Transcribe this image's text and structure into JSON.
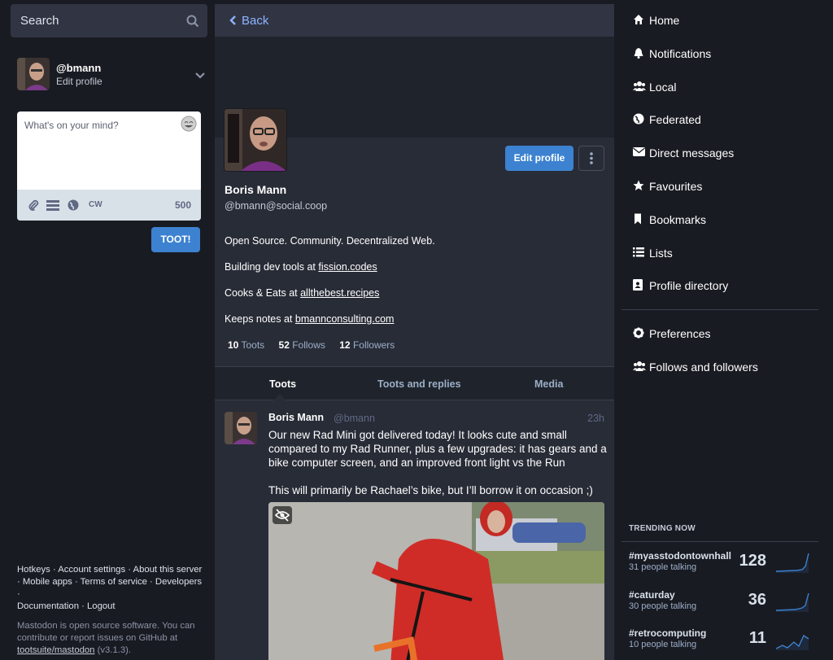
{
  "search": {
    "placeholder": "Search"
  },
  "account": {
    "handle": "@bmann",
    "edit_label": "Edit profile"
  },
  "composer": {
    "placeholder": "What's on your mind?",
    "cw_label": "CW",
    "char_count": "500",
    "toot_label": "TOOT!"
  },
  "footer": {
    "links_line1": "Hotkeys · Account settings · About this server",
    "links_line2": "· Mobile apps · Terms of service · Developers ·",
    "links_line3": "Documentation · Logout",
    "about_line1": "Mastodon is open source software. You can",
    "about_line2": "contribute or report issues on GitHub at",
    "repo": "tootsuite/mastodon",
    "version": " (v3.1.3)."
  },
  "header": {
    "back_label": "Back"
  },
  "profile": {
    "edit_label": "Edit profile",
    "name": "Boris Mann",
    "acct": "@bmann@social.coop",
    "bio1": "Open Source. Community. Decentralized Web.",
    "bio2_prefix": "Building dev tools at ",
    "bio2_link": "fission.codes",
    "bio3_prefix": "Cooks & Eats at ",
    "bio3_link": "allthebest.recipes",
    "bio4_prefix": "Keeps notes at ",
    "bio4_link": "bmannconsulting.com",
    "toots_count": "10",
    "toots_label": "Toots",
    "follows_count": "52",
    "follows_label": "Follows",
    "followers_count": "12",
    "followers_label": "Followers"
  },
  "tabs": [
    "Toots",
    "Toots and replies",
    "Media"
  ],
  "status": {
    "name": "Boris Mann",
    "acct": "@bmann",
    "time": "23h",
    "para1": "Our new Rad Mini got delivered today! It looks cute and small compared to my Rad Runner, plus a few upgrades: it has gears and a bike computer screen, and an improved front light vs the Run",
    "para2": "This will primarily be Rachael’s bike, but I’ll borrow it on occasion ;)"
  },
  "nav": {
    "home": "Home",
    "notifications": "Notifications",
    "local": "Local",
    "federated": "Federated",
    "direct": "Direct messages",
    "favourites": "Favourites",
    "bookmarks": "Bookmarks",
    "lists": "Lists",
    "directory": "Profile directory",
    "preferences": "Preferences",
    "follows": "Follows and followers"
  },
  "trending": {
    "heading": "TRENDING NOW",
    "items": [
      {
        "tag": "#myasstodontownhall",
        "talking": "31 people talking",
        "count": "128"
      },
      {
        "tag": "#caturday",
        "talking": "30 people talking",
        "count": "36"
      },
      {
        "tag": "#retrocomputing",
        "talking": "10 people talking",
        "count": "11"
      }
    ]
  },
  "colors": {
    "accent": "#3c82d0",
    "link": "#8cb4ff",
    "bg": "#191b22",
    "panel": "#282c37"
  }
}
